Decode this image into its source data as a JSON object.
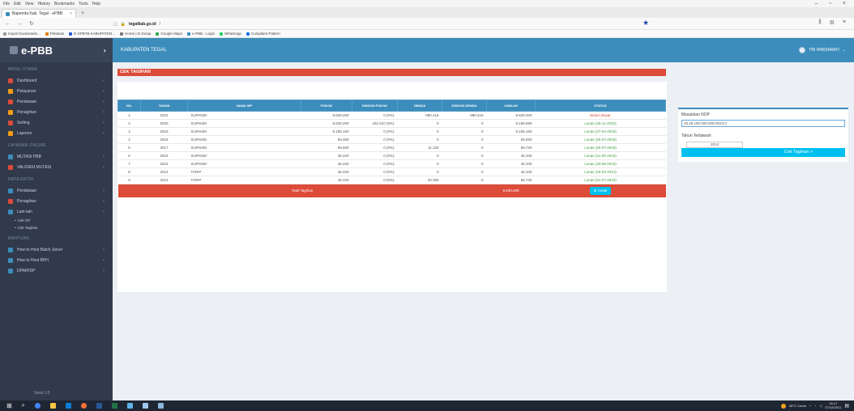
{
  "browser": {
    "menu": [
      "File",
      "Edit",
      "View",
      "History",
      "Bookmarks",
      "Tools",
      "Help"
    ],
    "tab_title": "Bapenda Kab. Tegal - ePBB",
    "tab_close": "×",
    "newtab": "+",
    "url_host": "tegalkab.go.id",
    "url_path": "/",
    "bookmarks": [
      "Import bookmarks...",
      "Pelatnas",
      "E-SPBTB KABUPATEN...",
      "Home | E-Gonja",
      "Google Maps",
      "e-PBB - Login",
      "WhatsApp",
      "Complaint Pattern"
    ]
  },
  "sidebar": {
    "brand": "e-PBB",
    "toggle": "◑",
    "section_main": "MENU UTAMA",
    "items_main": [
      {
        "label": "Dashboard",
        "color": "#dd4b39"
      },
      {
        "label": "Pelayanan",
        "color": "#f39c12"
      },
      {
        "label": "Pendataan",
        "color": "#dd4b39"
      },
      {
        "label": "Penagihan",
        "color": "#f39c12"
      },
      {
        "label": "Setting",
        "color": "#dd4b39"
      },
      {
        "label": "Laporan",
        "color": "#f39c12"
      }
    ],
    "section_online": "LAYANAN ONLINE",
    "items_online": [
      {
        "label": "MUTASI PBB",
        "color": "#3c8dbc"
      },
      {
        "label": "VALIDASI MUTASI",
        "color": "#dd4b39"
      }
    ],
    "section_data": "DATA ENTRI",
    "items_data": [
      {
        "label": "Pendataan",
        "color": "#3c8dbc"
      },
      {
        "label": "Penagihan",
        "color": "#dd4b39"
      },
      {
        "label": "Lain-lain",
        "color": "#3c8dbc"
      }
    ],
    "sub_items": [
      "Cek OP",
      "Cek Tagihan"
    ],
    "section_help": "BANTUAN",
    "items_help": [
      {
        "label": "How to Host Batch Joiner",
        "color": "#3c8dbc"
      },
      {
        "label": "How to Host BPH",
        "color": "#3c8dbc"
      },
      {
        "label": "DPM/FDP",
        "color": "#3c8dbc"
      }
    ],
    "version": "Versi 1.0"
  },
  "header": {
    "title": "KABUPATEN TEGAL",
    "user": "TRI RINDIARATI"
  },
  "cek": {
    "title": "CEK TAGIHAN",
    "columns": [
      "NO.",
      "TAHUN",
      "NAMA WP",
      "POKOK",
      "DISKON POKOK",
      "DENDA",
      "DISKON DENDA",
      "JUMLAH",
      "STATUS"
    ],
    "rows": [
      {
        "no": "1",
        "tahun": "2021",
        "nama": "SUPANDI",
        "pokok": "8.630.200",
        "diskon_pokok": "0 (0%)",
        "denda": "690.416",
        "diskon_denda": "690.416",
        "jumlah": "8.630.200",
        "status": "Belum Bayar",
        "belum": true
      },
      {
        "no": "2",
        "tahun": "2020",
        "nama": "SUPANDI",
        "pokok": "8.630.200",
        "diskon_pokok": "431.510 (5%)",
        "denda": "0",
        "diskon_denda": "0",
        "jumlah": "8.198.690",
        "status": "Lunas (26-11-2020)",
        "belum": false
      },
      {
        "no": "3",
        "tahun": "2019",
        "nama": "SUPANDI",
        "pokok": "8.195.160",
        "diskon_pokok": "0 (0%)",
        "denda": "0",
        "diskon_denda": "0",
        "jumlah": "8.195.160",
        "status": "Lunas (27-04-2019)",
        "belum": false
      },
      {
        "no": "4",
        "tahun": "2018",
        "nama": "SUPANDI",
        "pokok": "55.000",
        "diskon_pokok": "0 (0%)",
        "denda": "0",
        "diskon_denda": "0",
        "jumlah": "55.000",
        "status": "Lunas (26-07-2018)",
        "belum": false
      },
      {
        "no": "5",
        "tahun": "2017",
        "nama": "SUPANDI",
        "pokok": "55.600",
        "diskon_pokok": "0 (0%)",
        "denda": "11.120",
        "diskon_denda": "0",
        "jumlah": "66.720",
        "status": "Lunas (26-07-2018)",
        "belum": false
      },
      {
        "no": "6",
        "tahun": "2016",
        "nama": "SUPANDI",
        "pokok": "46.340",
        "diskon_pokok": "0 (0%)",
        "denda": "0",
        "diskon_denda": "0",
        "jumlah": "46.340",
        "status": "Lunas (21-06-2016)",
        "belum": false
      },
      {
        "no": "7",
        "tahun": "2015",
        "nama": "SUPANDI",
        "pokok": "46.340",
        "diskon_pokok": "0 (0%)",
        "denda": "0",
        "diskon_denda": "0",
        "jumlah": "46.340",
        "status": "Lunas (20-08-2015)",
        "belum": false
      },
      {
        "no": "8",
        "tahun": "2014",
        "nama": "TARIP",
        "pokok": "46.340",
        "diskon_pokok": "0 (0%)",
        "denda": "0",
        "diskon_denda": "0",
        "jumlah": "46.340",
        "status": "Lunas (29-03-2014)",
        "belum": false
      },
      {
        "no": "9",
        "tahun": "2013",
        "nama": "TARIP",
        "pokok": "46.340",
        "diskon_pokok": "0 (0%)",
        "denda": "20.390",
        "diskon_denda": "0",
        "jumlah": "66.730",
        "status": "Lunas (01-07-2013)",
        "belum": false
      }
    ],
    "total_label": "Total Tagihan",
    "total_value": "8.630.200",
    "cetak_label": "⊕ Cetak"
  },
  "nop": {
    "label": "Masukkan NOP",
    "value": "33.28.190.009.008-0023.0",
    "year_label": "Tahun Terbawah",
    "year_value": "2013",
    "button": "Cek Tagihan >"
  },
  "taskbar": {
    "weather": "28°C Cerah",
    "time": "18.17",
    "date": "27/12/2021"
  }
}
